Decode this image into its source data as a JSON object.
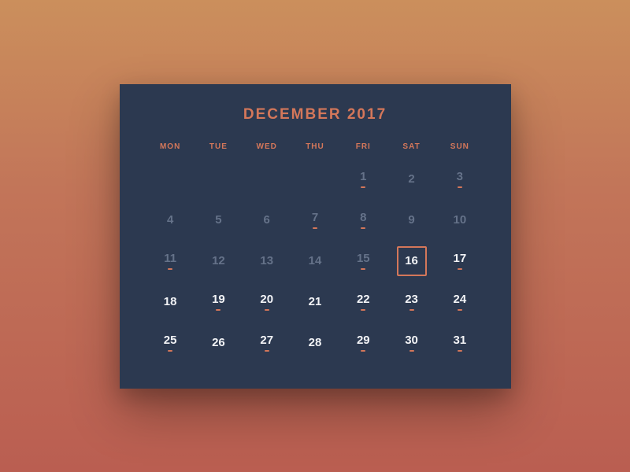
{
  "header": {
    "title": "DECEMBER 2017"
  },
  "dow": [
    "MON",
    "TUE",
    "WED",
    "THU",
    "FRI",
    "SAT",
    "SUN"
  ],
  "leadingBlanks": 4,
  "today": 16,
  "days": [
    {
      "n": 1,
      "event": true,
      "past": true
    },
    {
      "n": 2,
      "event": false,
      "past": true
    },
    {
      "n": 3,
      "event": true,
      "past": true
    },
    {
      "n": 4,
      "event": false,
      "past": true
    },
    {
      "n": 5,
      "event": false,
      "past": true
    },
    {
      "n": 6,
      "event": false,
      "past": true
    },
    {
      "n": 7,
      "event": true,
      "past": true
    },
    {
      "n": 8,
      "event": true,
      "past": true
    },
    {
      "n": 9,
      "event": false,
      "past": true
    },
    {
      "n": 10,
      "event": false,
      "past": true
    },
    {
      "n": 11,
      "event": true,
      "past": true
    },
    {
      "n": 12,
      "event": false,
      "past": true
    },
    {
      "n": 13,
      "event": false,
      "past": true
    },
    {
      "n": 14,
      "event": false,
      "past": true
    },
    {
      "n": 15,
      "event": true,
      "past": true
    },
    {
      "n": 16,
      "event": false,
      "past": false
    },
    {
      "n": 17,
      "event": true,
      "past": false
    },
    {
      "n": 18,
      "event": false,
      "past": false
    },
    {
      "n": 19,
      "event": true,
      "past": false
    },
    {
      "n": 20,
      "event": true,
      "past": false
    },
    {
      "n": 21,
      "event": false,
      "past": false
    },
    {
      "n": 22,
      "event": true,
      "past": false
    },
    {
      "n": 23,
      "event": true,
      "past": false
    },
    {
      "n": 24,
      "event": true,
      "past": false
    },
    {
      "n": 25,
      "event": true,
      "past": false
    },
    {
      "n": 26,
      "event": false,
      "past": false
    },
    {
      "n": 27,
      "event": true,
      "past": false
    },
    {
      "n": 28,
      "event": false,
      "past": false
    },
    {
      "n": 29,
      "event": true,
      "past": false
    },
    {
      "n": 30,
      "event": true,
      "past": false
    },
    {
      "n": 31,
      "event": true,
      "past": false
    }
  ]
}
